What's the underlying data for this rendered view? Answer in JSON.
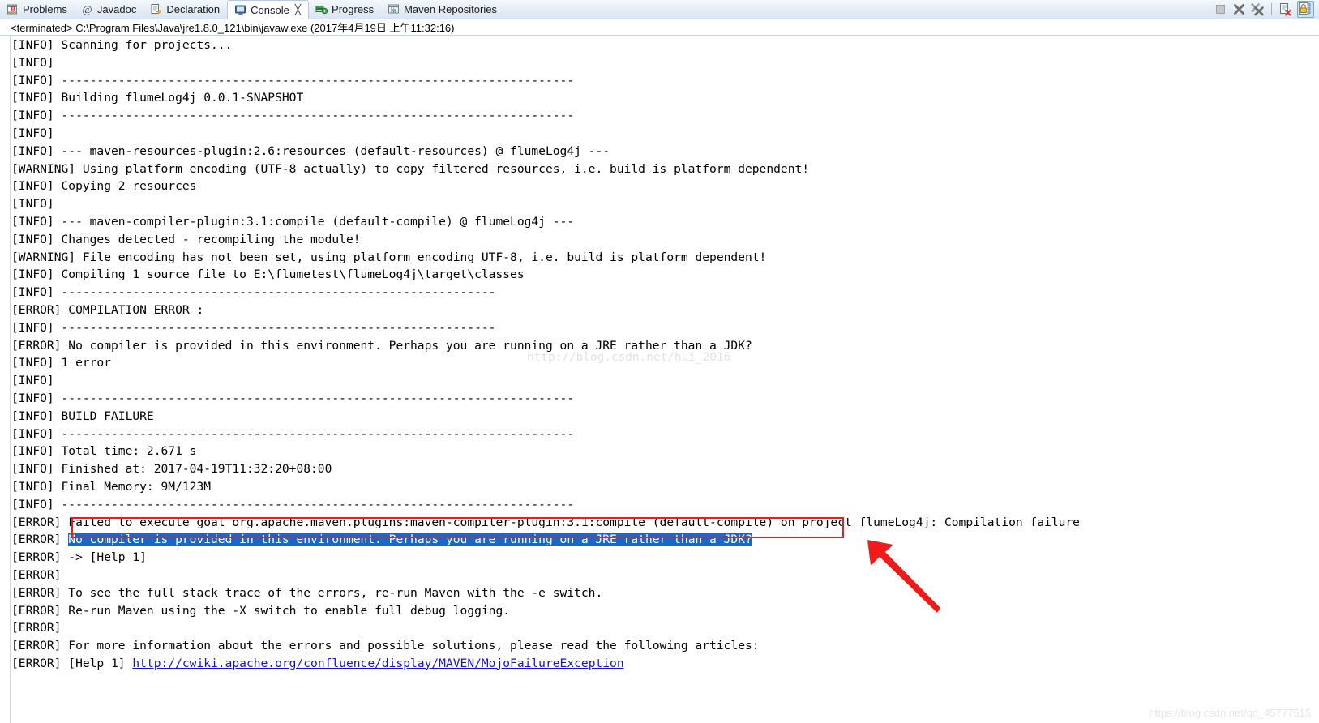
{
  "window": {
    "app": "Eclipse IDE",
    "view": "Console"
  },
  "tabs": [
    {
      "id": "problems",
      "label": "Problems",
      "icon": "problems-icon",
      "active": false,
      "closeable": false
    },
    {
      "id": "javadoc",
      "label": "Javadoc",
      "icon": "javadoc-at-icon",
      "active": false,
      "closeable": false
    },
    {
      "id": "declaration",
      "label": "Declaration",
      "icon": "declaration-icon",
      "active": false,
      "closeable": false
    },
    {
      "id": "console",
      "label": "Console",
      "icon": "console-icon",
      "active": true,
      "closeable": true
    },
    {
      "id": "progress",
      "label": "Progress",
      "icon": "progress-icon",
      "active": false,
      "closeable": false
    },
    {
      "id": "maven-repositories",
      "label": "Maven Repositories",
      "icon": "maven-repositories-icon",
      "active": false,
      "closeable": false
    }
  ],
  "tab_close_glyph": "╳",
  "toolbar": [
    {
      "id": "terminate",
      "name": "stop-square-icon",
      "enabled": false,
      "boxed": false
    },
    {
      "id": "remove-launch",
      "name": "remove-x-icon",
      "enabled": true,
      "boxed": false
    },
    {
      "id": "remove-all-terminated",
      "name": "remove-all-xx-icon",
      "enabled": true,
      "boxed": false
    },
    {
      "id": "separator",
      "name": "toolbar-separator",
      "enabled": false,
      "boxed": false
    },
    {
      "id": "clear-console",
      "name": "clear-console-icon",
      "enabled": true,
      "boxed": false
    },
    {
      "id": "scroll-lock",
      "name": "scroll-lock-icon",
      "enabled": true,
      "boxed": true
    }
  ],
  "process_header": {
    "status": "<terminated>",
    "command": "C:\\Program Files\\Java\\jre1.8.0_121\\bin\\javaw.exe",
    "timestamp": "(2017年4月19日 上午11:32:16)",
    "full": "<terminated> C:\\Program Files\\Java\\jre1.8.0_121\\bin\\javaw.exe (2017年4月19日 上午11:32:16)"
  },
  "console": {
    "divider_long": "------------------------------------------------------------------------",
    "divider_short": "-------------------------------------------------------------",
    "lines": [
      {
        "t": "[INFO] Scanning for projects..."
      },
      {
        "t": "[INFO] "
      },
      {
        "t": "[INFO] ------------------------------------------------------------------------"
      },
      {
        "t": "[INFO] Building flumeLog4j 0.0.1-SNAPSHOT"
      },
      {
        "t": "[INFO] ------------------------------------------------------------------------"
      },
      {
        "t": "[INFO] "
      },
      {
        "t": "[INFO] --- maven-resources-plugin:2.6:resources (default-resources) @ flumeLog4j ---"
      },
      {
        "t": "[WARNING] Using platform encoding (UTF-8 actually) to copy filtered resources, i.e. build is platform dependent!"
      },
      {
        "t": "[INFO] Copying 2 resources"
      },
      {
        "t": "[INFO] "
      },
      {
        "t": "[INFO] --- maven-compiler-plugin:3.1:compile (default-compile) @ flumeLog4j ---"
      },
      {
        "t": "[INFO] Changes detected - recompiling the module!"
      },
      {
        "t": "[WARNING] File encoding has not been set, using platform encoding UTF-8, i.e. build is platform dependent!"
      },
      {
        "t": "[INFO] Compiling 1 source file to E:\\flumetest\\flumeLog4j\\target\\classes"
      },
      {
        "t": "[INFO] -------------------------------------------------------------"
      },
      {
        "t": "[ERROR] COMPILATION ERROR : "
      },
      {
        "t": "[INFO] -------------------------------------------------------------"
      },
      {
        "t": "[ERROR] No compiler is provided in this environment. Perhaps you are running on a JRE rather than a JDK?"
      },
      {
        "t": "[INFO] 1 error"
      },
      {
        "t": "[INFO] "
      },
      {
        "t": "[INFO] ------------------------------------------------------------------------"
      },
      {
        "t": "[INFO] BUILD FAILURE"
      },
      {
        "t": "[INFO] ------------------------------------------------------------------------"
      },
      {
        "t": "[INFO] Total time: 2.671 s"
      },
      {
        "t": "[INFO] Finished at: 2017-04-19T11:32:20+08:00"
      },
      {
        "t": "[INFO] Final Memory: 9M/123M"
      },
      {
        "t": "[INFO] ------------------------------------------------------------------------"
      },
      {
        "t": "[ERROR] Failed to execute goal org.apache.maven.plugins:maven-compiler-plugin:3.1:compile (default-compile) on project flumeLog4j: Compilation failure"
      },
      {
        "prefix": "[ERROR] ",
        "selected": "No compiler is provided in this environment. Perhaps you are running on a JRE rather than a JDK?",
        "highlight": true
      },
      {
        "t": "[ERROR] -> [Help 1]"
      },
      {
        "t": "[ERROR] "
      },
      {
        "t": "[ERROR] To see the full stack trace of the errors, re-run Maven with the -e switch."
      },
      {
        "t": "[ERROR] Re-run Maven using the -X switch to enable full debug logging."
      },
      {
        "t": "[ERROR] "
      },
      {
        "t": "[ERROR] For more information about the errors and possible solutions, please read the following articles:"
      },
      {
        "prefix": "[ERROR] [Help 1] ",
        "link": "http://cwiki.apache.org/confluence/display/MAVEN/MojoFailureException"
      }
    ]
  },
  "annotations": {
    "highlight_box_color": "#ef1b1b",
    "arrow_color": "#ef1b1b",
    "selection_color": "#1569c7",
    "link_color": "#1414cc"
  },
  "watermarks": {
    "center": "http://blog.csdn.net/hui_2016",
    "bottom_right": "https://blog.csdn.net/qq_45777515"
  }
}
